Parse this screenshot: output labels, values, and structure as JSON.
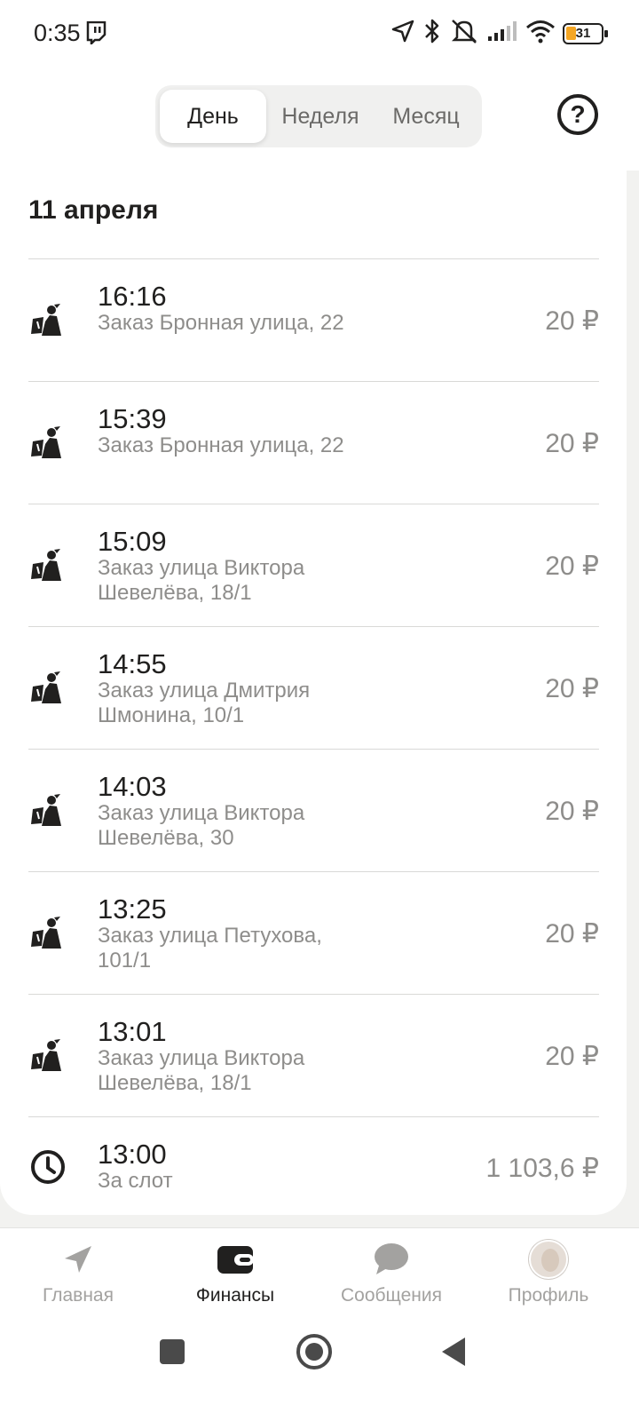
{
  "status_bar": {
    "time": "0:35",
    "battery_level": "31",
    "icons": [
      "twitch-icon",
      "location-arrow-icon",
      "bluetooth-icon",
      "mute-icon",
      "signal-icon",
      "wifi-icon",
      "battery-icon"
    ]
  },
  "period_tabs": {
    "day": "День",
    "week": "Неделя",
    "month": "Месяц",
    "selected": "day"
  },
  "help": {
    "label": "?"
  },
  "date_title": "11 апреля",
  "transactions": [
    {
      "time": "16:16",
      "description": "Заказ Бронная улица, 22",
      "amount": "20 ₽",
      "icon": "courier-icon"
    },
    {
      "time": "15:39",
      "description": "Заказ Бронная улица, 22",
      "amount": "20 ₽",
      "icon": "courier-icon"
    },
    {
      "time": "15:09",
      "description": "Заказ улица Виктора Шевелёва, 18/1",
      "amount": "20 ₽",
      "icon": "courier-icon"
    },
    {
      "time": "14:55",
      "description": "Заказ улица Дмитрия Шмонина, 10/1",
      "amount": "20 ₽",
      "icon": "courier-icon"
    },
    {
      "time": "14:03",
      "description": "Заказ улица Виктора Шевелёва, 30",
      "amount": "20 ₽",
      "icon": "courier-icon"
    },
    {
      "time": "13:25",
      "description": "Заказ улица Петухова, 101/1",
      "amount": "20 ₽",
      "icon": "courier-icon"
    },
    {
      "time": "13:01",
      "description": "Заказ улица Виктора Шевелёва, 18/1",
      "amount": "20 ₽",
      "icon": "courier-icon"
    },
    {
      "time": "13:00",
      "description": "За слот",
      "amount": "1 103,6 ₽",
      "icon": "clock-icon"
    }
  ],
  "bottom_nav": {
    "items": [
      {
        "label": "Главная",
        "icon": "navigation-arrow-icon",
        "active": false
      },
      {
        "label": "Финансы",
        "icon": "wallet-icon",
        "active": true
      },
      {
        "label": "Сообщения",
        "icon": "chat-bubble-icon",
        "active": false
      },
      {
        "label": "Профиль",
        "icon": "avatar",
        "active": false
      }
    ]
  },
  "colors": {
    "text_primary": "#21201f",
    "text_secondary": "#8e8d8b",
    "nav_inactive": "#a3a2a0",
    "background": "#f2f2f0",
    "battery_accent": "#f5a623"
  }
}
